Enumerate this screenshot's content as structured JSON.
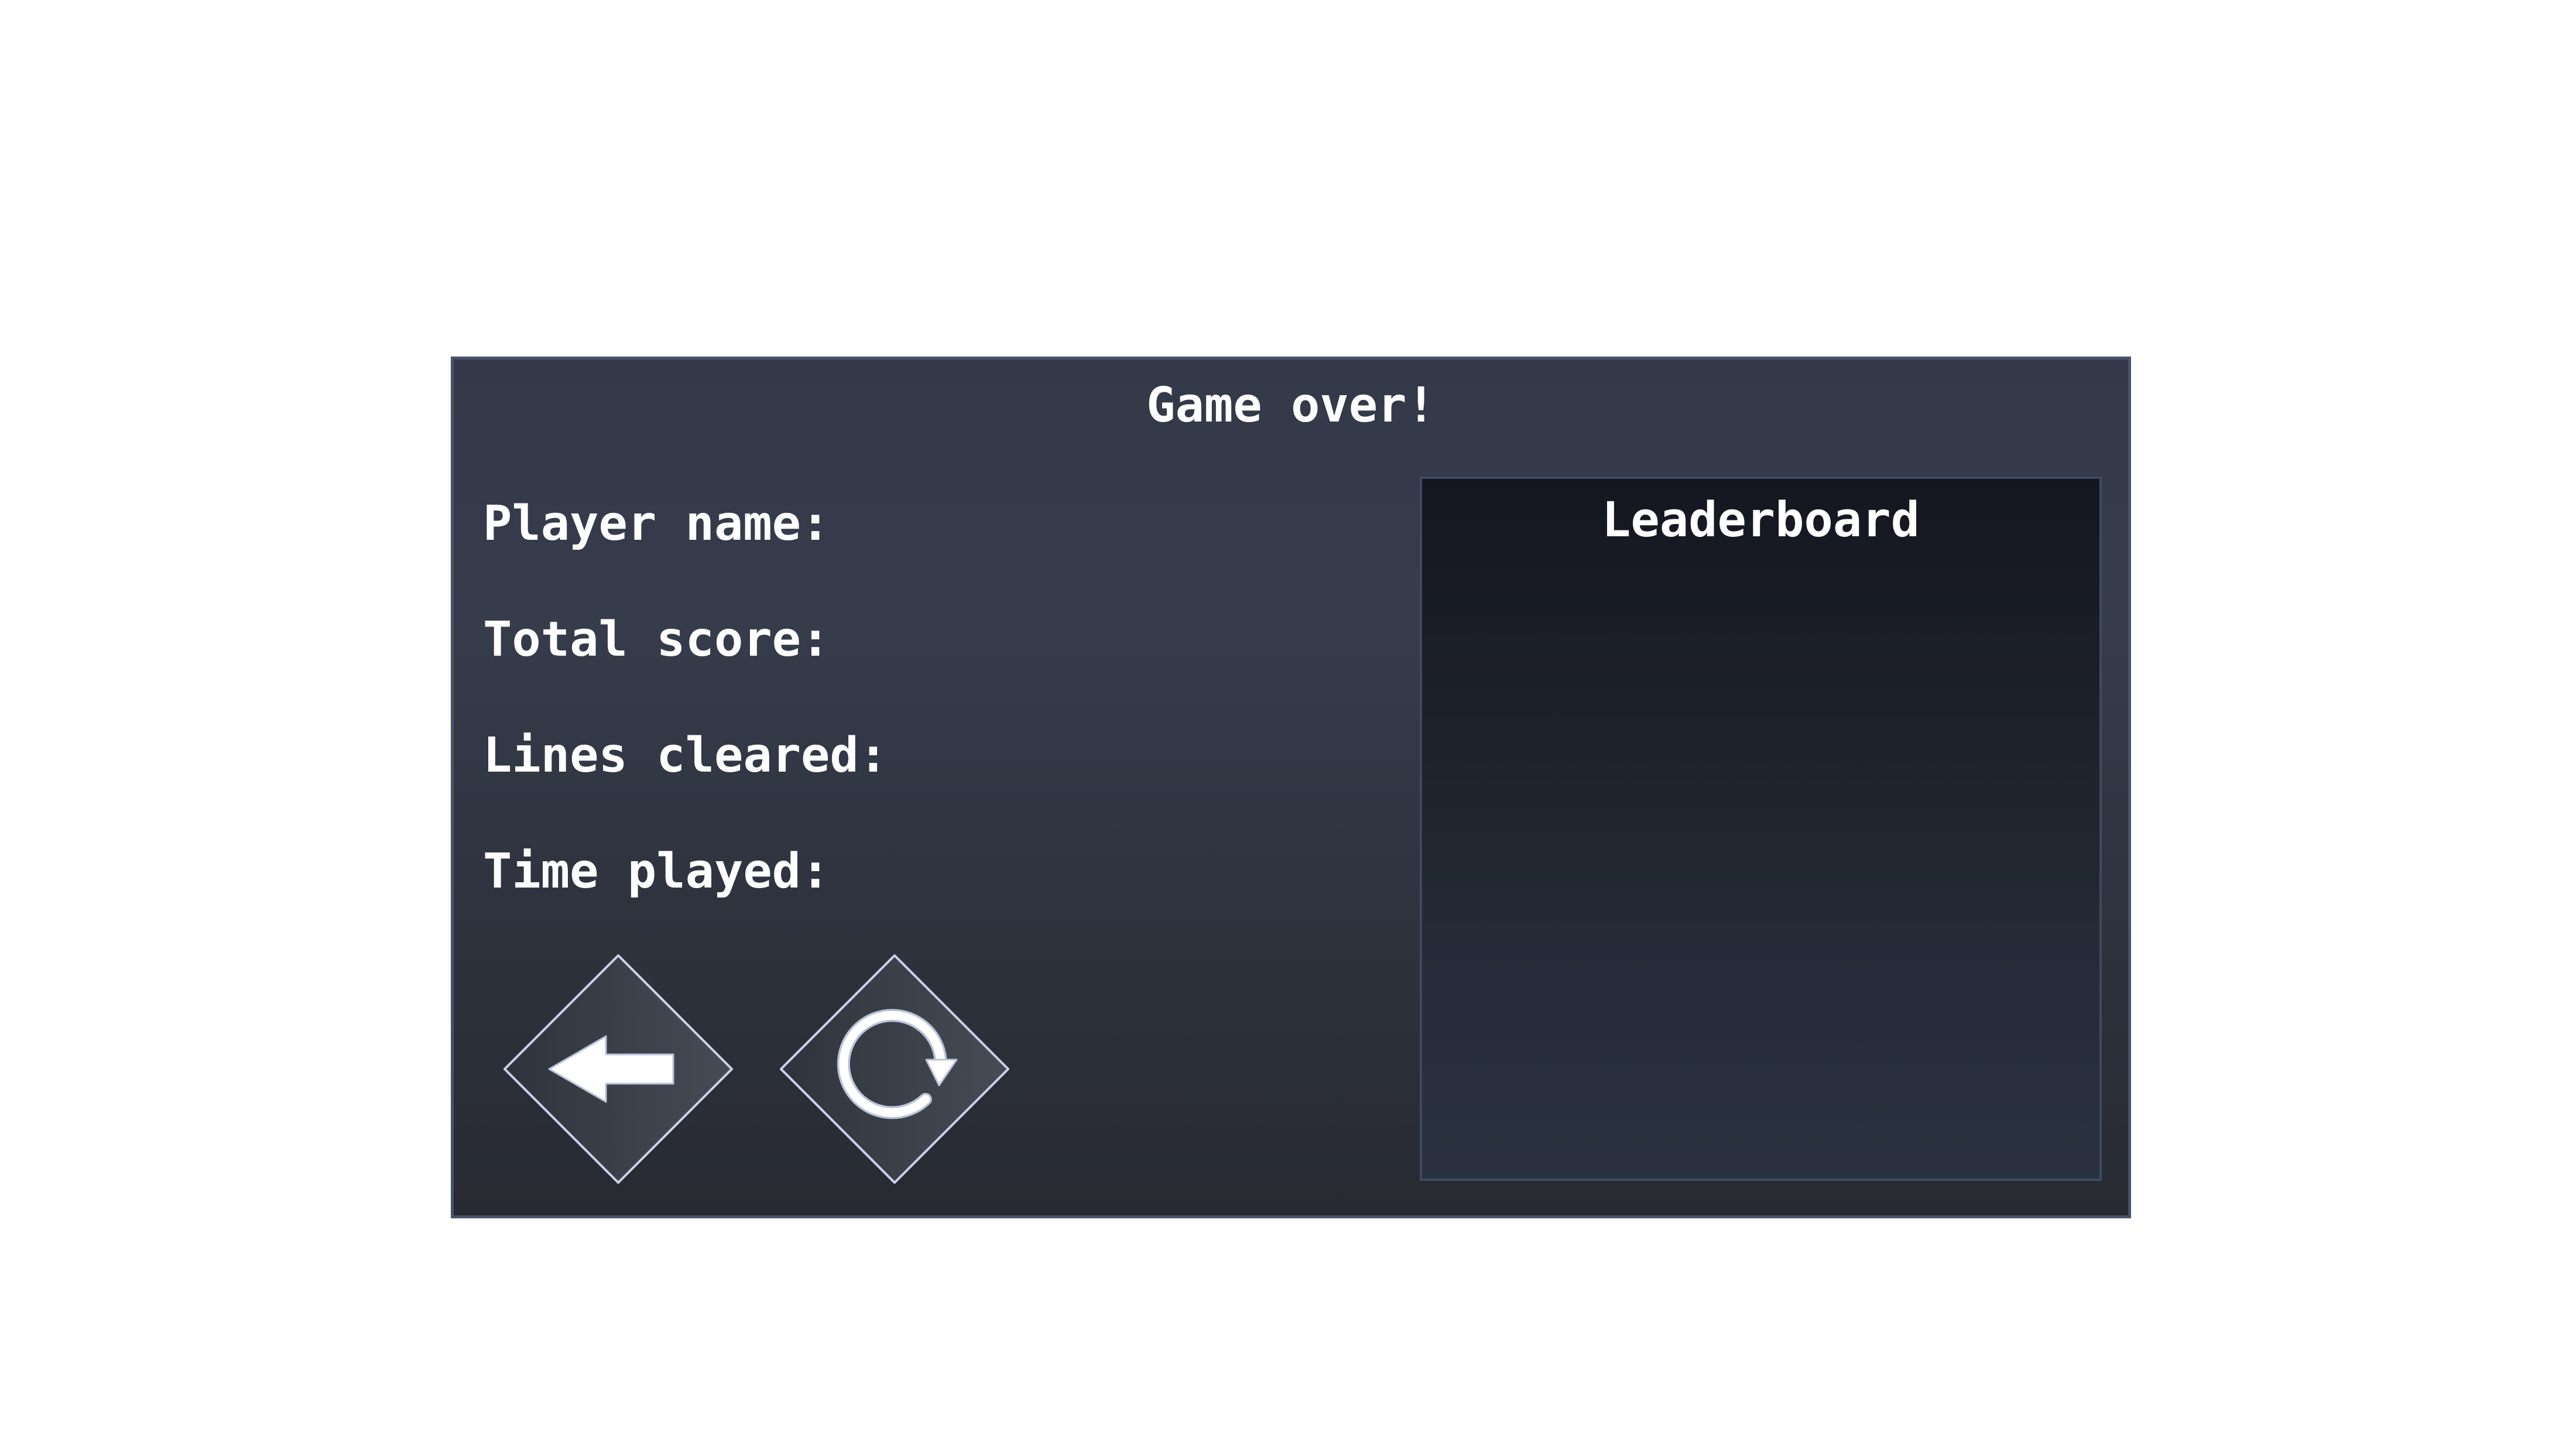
{
  "dialog": {
    "title": "Game over!"
  },
  "stats": {
    "player_name": {
      "label": "Player name:",
      "value": ""
    },
    "total_score": {
      "label": "Total score:",
      "value": ""
    },
    "lines_cleared": {
      "label": "Lines cleared:",
      "value": ""
    },
    "time_played": {
      "label": "Time played:",
      "value": ""
    }
  },
  "leaderboard": {
    "title": "Leaderboard",
    "entries": []
  },
  "buttons": {
    "back": {
      "icon": "arrow-left-icon"
    },
    "restart": {
      "icon": "restart-icon"
    }
  },
  "colors": {
    "panel_border": "#48536a",
    "text": "#ffffff",
    "button_outline": "#c8d2ea"
  }
}
